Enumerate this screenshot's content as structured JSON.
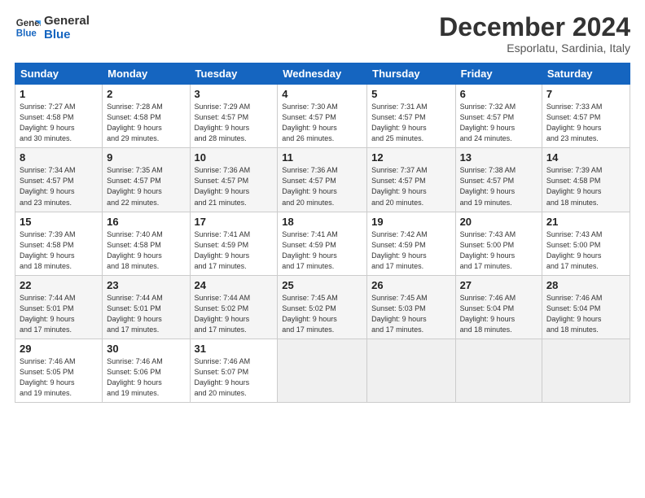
{
  "header": {
    "logo_line1": "General",
    "logo_line2": "Blue",
    "month": "December 2024",
    "location": "Esporlatu, Sardinia, Italy"
  },
  "days_of_week": [
    "Sunday",
    "Monday",
    "Tuesday",
    "Wednesday",
    "Thursday",
    "Friday",
    "Saturday"
  ],
  "weeks": [
    [
      {
        "day": "1",
        "info": "Sunrise: 7:27 AM\nSunset: 4:58 PM\nDaylight: 9 hours\nand 30 minutes."
      },
      {
        "day": "2",
        "info": "Sunrise: 7:28 AM\nSunset: 4:58 PM\nDaylight: 9 hours\nand 29 minutes."
      },
      {
        "day": "3",
        "info": "Sunrise: 7:29 AM\nSunset: 4:57 PM\nDaylight: 9 hours\nand 28 minutes."
      },
      {
        "day": "4",
        "info": "Sunrise: 7:30 AM\nSunset: 4:57 PM\nDaylight: 9 hours\nand 26 minutes."
      },
      {
        "day": "5",
        "info": "Sunrise: 7:31 AM\nSunset: 4:57 PM\nDaylight: 9 hours\nand 25 minutes."
      },
      {
        "day": "6",
        "info": "Sunrise: 7:32 AM\nSunset: 4:57 PM\nDaylight: 9 hours\nand 24 minutes."
      },
      {
        "day": "7",
        "info": "Sunrise: 7:33 AM\nSunset: 4:57 PM\nDaylight: 9 hours\nand 23 minutes."
      }
    ],
    [
      {
        "day": "8",
        "info": "Sunrise: 7:34 AM\nSunset: 4:57 PM\nDaylight: 9 hours\nand 23 minutes."
      },
      {
        "day": "9",
        "info": "Sunrise: 7:35 AM\nSunset: 4:57 PM\nDaylight: 9 hours\nand 22 minutes."
      },
      {
        "day": "10",
        "info": "Sunrise: 7:36 AM\nSunset: 4:57 PM\nDaylight: 9 hours\nand 21 minutes."
      },
      {
        "day": "11",
        "info": "Sunrise: 7:36 AM\nSunset: 4:57 PM\nDaylight: 9 hours\nand 20 minutes."
      },
      {
        "day": "12",
        "info": "Sunrise: 7:37 AM\nSunset: 4:57 PM\nDaylight: 9 hours\nand 20 minutes."
      },
      {
        "day": "13",
        "info": "Sunrise: 7:38 AM\nSunset: 4:57 PM\nDaylight: 9 hours\nand 19 minutes."
      },
      {
        "day": "14",
        "info": "Sunrise: 7:39 AM\nSunset: 4:58 PM\nDaylight: 9 hours\nand 18 minutes."
      }
    ],
    [
      {
        "day": "15",
        "info": "Sunrise: 7:39 AM\nSunset: 4:58 PM\nDaylight: 9 hours\nand 18 minutes."
      },
      {
        "day": "16",
        "info": "Sunrise: 7:40 AM\nSunset: 4:58 PM\nDaylight: 9 hours\nand 18 minutes."
      },
      {
        "day": "17",
        "info": "Sunrise: 7:41 AM\nSunset: 4:59 PM\nDaylight: 9 hours\nand 17 minutes."
      },
      {
        "day": "18",
        "info": "Sunrise: 7:41 AM\nSunset: 4:59 PM\nDaylight: 9 hours\nand 17 minutes."
      },
      {
        "day": "19",
        "info": "Sunrise: 7:42 AM\nSunset: 4:59 PM\nDaylight: 9 hours\nand 17 minutes."
      },
      {
        "day": "20",
        "info": "Sunrise: 7:43 AM\nSunset: 5:00 PM\nDaylight: 9 hours\nand 17 minutes."
      },
      {
        "day": "21",
        "info": "Sunrise: 7:43 AM\nSunset: 5:00 PM\nDaylight: 9 hours\nand 17 minutes."
      }
    ],
    [
      {
        "day": "22",
        "info": "Sunrise: 7:44 AM\nSunset: 5:01 PM\nDaylight: 9 hours\nand 17 minutes."
      },
      {
        "day": "23",
        "info": "Sunrise: 7:44 AM\nSunset: 5:01 PM\nDaylight: 9 hours\nand 17 minutes."
      },
      {
        "day": "24",
        "info": "Sunrise: 7:44 AM\nSunset: 5:02 PM\nDaylight: 9 hours\nand 17 minutes."
      },
      {
        "day": "25",
        "info": "Sunrise: 7:45 AM\nSunset: 5:02 PM\nDaylight: 9 hours\nand 17 minutes."
      },
      {
        "day": "26",
        "info": "Sunrise: 7:45 AM\nSunset: 5:03 PM\nDaylight: 9 hours\nand 17 minutes."
      },
      {
        "day": "27",
        "info": "Sunrise: 7:46 AM\nSunset: 5:04 PM\nDaylight: 9 hours\nand 18 minutes."
      },
      {
        "day": "28",
        "info": "Sunrise: 7:46 AM\nSunset: 5:04 PM\nDaylight: 9 hours\nand 18 minutes."
      }
    ],
    [
      {
        "day": "29",
        "info": "Sunrise: 7:46 AM\nSunset: 5:05 PM\nDaylight: 9 hours\nand 19 minutes."
      },
      {
        "day": "30",
        "info": "Sunrise: 7:46 AM\nSunset: 5:06 PM\nDaylight: 9 hours\nand 19 minutes."
      },
      {
        "day": "31",
        "info": "Sunrise: 7:46 AM\nSunset: 5:07 PM\nDaylight: 9 hours\nand 20 minutes."
      },
      {
        "day": "",
        "info": ""
      },
      {
        "day": "",
        "info": ""
      },
      {
        "day": "",
        "info": ""
      },
      {
        "day": "",
        "info": ""
      }
    ]
  ]
}
